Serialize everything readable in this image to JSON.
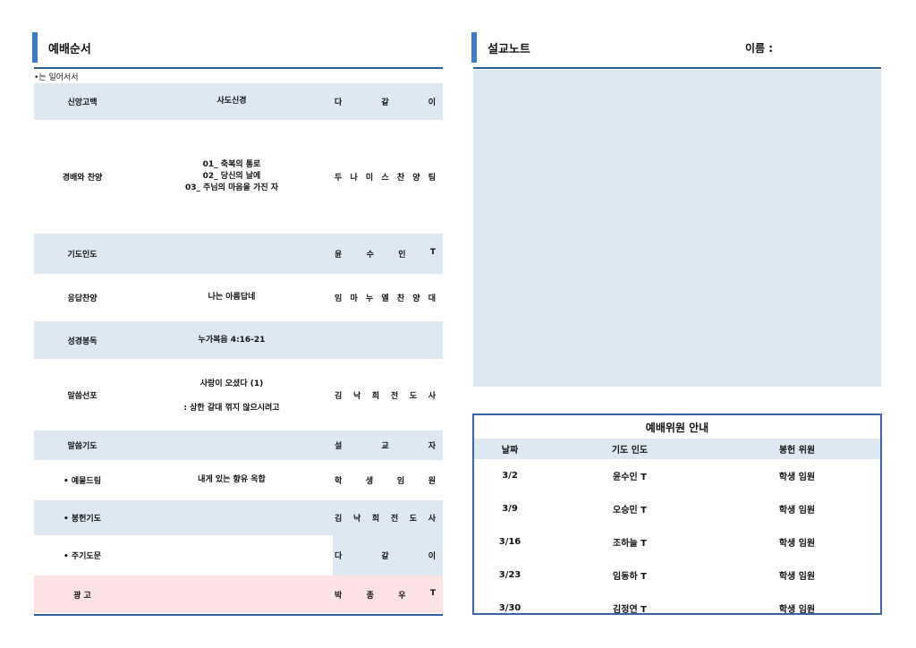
{
  "left": {
    "title": "예배순서",
    "note": "•는 일어서서",
    "rows": [
      {
        "label": "신앙고백",
        "middle": [
          "사도신경"
        ],
        "right": [
          "다",
          "같",
          "이"
        ],
        "style": "blue",
        "h": 41
      },
      {
        "label": "경배와 찬양",
        "middle": [
          "01_ 축복의 통로",
          "02_ 당신의 날에",
          "03_ 주님의 마음을 가진 자"
        ],
        "right": [
          "두",
          "나",
          "미",
          "스",
          "찬",
          "양",
          "팀"
        ],
        "style": "white",
        "h": 127
      },
      {
        "label": "기도인도",
        "middle": [],
        "right": [
          "윤",
          "수",
          "인",
          "T"
        ],
        "style": "blue",
        "h": 45
      },
      {
        "label": "응답찬양",
        "middle": [
          "나는 아름답네"
        ],
        "right": [
          "임",
          "마",
          "누",
          "엘",
          "찬",
          "양",
          "대"
        ],
        "style": "white",
        "h": 53
      },
      {
        "label": "성경봉독",
        "middle": [
          "누가복음 4:16-21"
        ],
        "right": [],
        "style": "blue",
        "h": 42
      },
      {
        "label": "말씀선포",
        "middle": [
          "사랑이 오셨다 (1)",
          ": 상한 갈대 꺾지 않으시려고"
        ],
        "right": [
          "김",
          "낙",
          "희",
          "전",
          "도",
          "사"
        ],
        "style": "white",
        "h": 80
      },
      {
        "label": "말씀기도",
        "middle": [],
        "right": [
          "설",
          "교",
          "자"
        ],
        "style": "blue",
        "h": 33
      },
      {
        "label": "• 예물드림",
        "middle": [
          "내게 있는 향유 옥합"
        ],
        "right": [
          "학",
          "생",
          "임",
          "원"
        ],
        "style": "white",
        "h": 45
      },
      {
        "label": "• 봉헌기도",
        "middle": [],
        "right": [
          "김",
          "낙",
          "희",
          "전",
          "도",
          "사"
        ],
        "style": "blue",
        "h": 39
      },
      {
        "label": "• 주기도문",
        "middle": [],
        "right": [
          "다",
          "같",
          "이"
        ],
        "style": "mixed",
        "h": 45
      },
      {
        "label": "광  고",
        "middle": [],
        "right": [
          "박",
          "종",
          "우",
          "T"
        ],
        "style": "pink",
        "h": 42
      }
    ]
  },
  "right": {
    "title": "설교노트",
    "name_label": "이름 :",
    "staff": {
      "title": "예배위원 안내",
      "headers": [
        "날짜",
        "기도 인도",
        "봉헌 위원"
      ],
      "rows": [
        [
          "3/2",
          "윤수인 T",
          "학생 임원"
        ],
        [
          "3/9",
          "오승민 T",
          "학생 임원"
        ],
        [
          "3/16",
          "조하늘 T",
          "학생 임원"
        ],
        [
          "3/23",
          "임동하 T",
          "학생 임원"
        ],
        [
          "3/30",
          "김정연 T",
          "학생 임원"
        ]
      ]
    }
  },
  "colors": {
    "accent": "#3d7cc9",
    "rule": "#2e5e9e",
    "row_blue": "#dde8f3",
    "row_pink": "#fde3e5",
    "box_border": "#3b63a8"
  }
}
